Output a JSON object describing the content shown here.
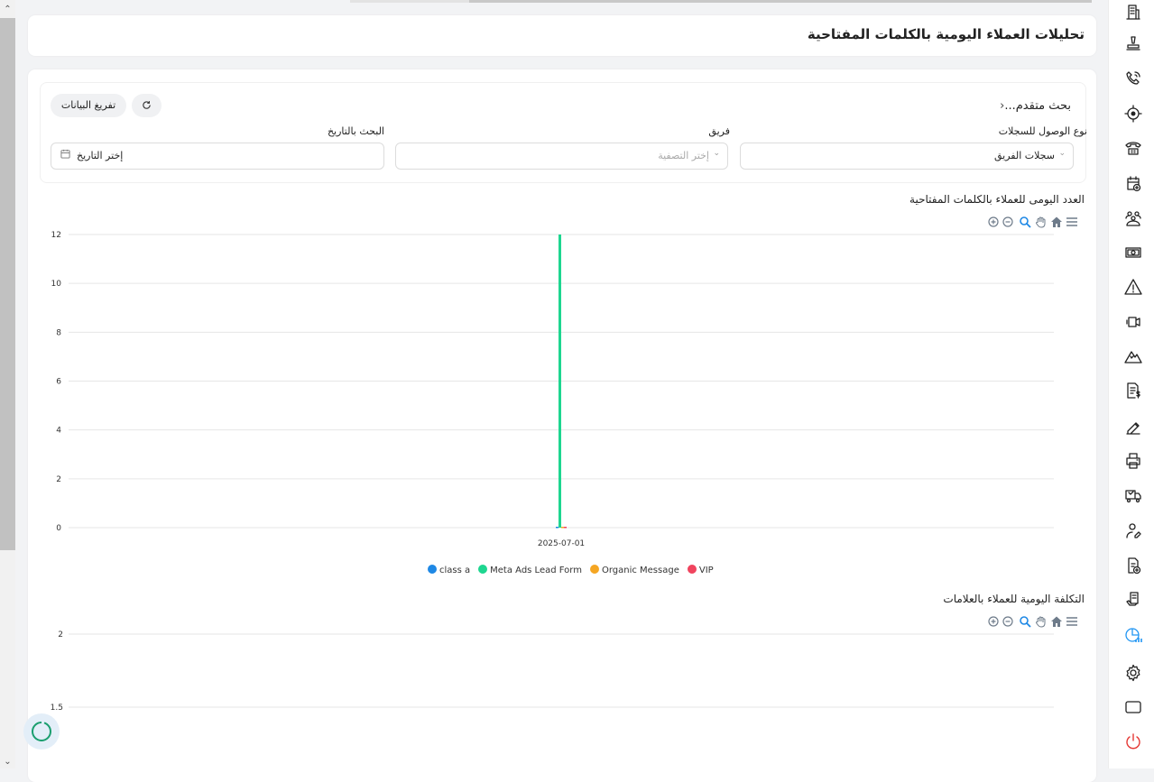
{
  "page": {
    "title": "تحليلات العملاء اليومية بالكلمات المفتاحية"
  },
  "filters": {
    "advanced_search": "بحث متقدم...",
    "export_button": "تفريغ البيانات",
    "refresh_icon": "refresh-icon",
    "access_type": {
      "label": "نوع الوصول للسجلات",
      "value": "سجلات الفريق"
    },
    "team": {
      "label": "فريق",
      "placeholder": "إختر التصفية"
    },
    "date": {
      "label": "البحث بالتاريخ",
      "placeholder": "إختر التاريخ"
    }
  },
  "toolbar_icons": [
    "zoom-in-icon",
    "zoom-out-icon",
    "zoom-selection-icon",
    "pan-icon",
    "reset-home-icon",
    "menu-icon"
  ],
  "sidebar_icons": [
    "building-icon",
    "stamp-icon",
    "phone-call-icon",
    "target-icon",
    "telephone-icon",
    "calendar-plus-icon",
    "group-icon",
    "money-icon",
    "warning-icon",
    "video-icon",
    "mountain-icon",
    "invoice-dollar-icon",
    "signature-icon",
    "printer-icon",
    "box-truck-icon",
    "user-edit-icon",
    "add-document-icon",
    "hand-document-icon",
    "analytics-icon",
    "settings-icon",
    "window-icon",
    "power-icon"
  ],
  "colors": {
    "accent": "#1e88e5",
    "active_sidebar": "#2196f3",
    "power": "#e53935",
    "grid": "#e6e6e6"
  },
  "chart_data": [
    {
      "type": "bar",
      "title": "العدد اليومى للعملاء بالكلمات المفتاحية",
      "categories": [
        "2025-07-01"
      ],
      "series": [
        {
          "name": "class a",
          "color": "#1e88e5",
          "values": [
            0
          ]
        },
        {
          "name": "Meta Ads Lead Form",
          "color": "#1ed690",
          "values": [
            12
          ]
        },
        {
          "name": "Organic Message",
          "color": "#f5a623",
          "values": [
            0
          ]
        },
        {
          "name": "VIP",
          "color": "#f0445e",
          "values": [
            0
          ]
        }
      ],
      "yticks": [
        0,
        2,
        4,
        6,
        8,
        10,
        12
      ],
      "ylim": [
        0,
        12
      ],
      "grid": true,
      "legend": "bottom"
    },
    {
      "type": "line",
      "title": "التكلفة اليومية للعملاء بالعلامات",
      "yticks": [
        "1.5",
        "2"
      ],
      "grid": true
    }
  ]
}
